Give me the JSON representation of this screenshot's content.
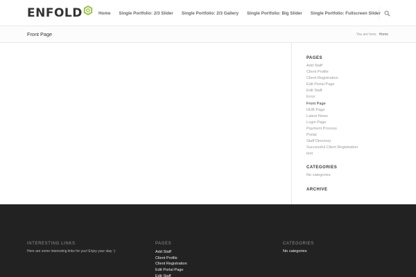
{
  "header": {
    "logo_text": "ENFOLD",
    "nav": [
      "Home",
      "Single Portfolio: 2/3 Slider",
      "Single Portfolio: 2/3 Gallery",
      "Single Portfolio: Big Slider",
      "Single Portfolio: Fullscreen Slider"
    ],
    "search_icon": "search-icon",
    "accent_color": "#9cc2464"
  },
  "titlebar": {
    "title": "Front Page",
    "breadcrumb_prefix": "You are here:",
    "breadcrumb_home": "Home"
  },
  "sidebar": {
    "pages_title": "PAGES",
    "pages": [
      "Add Staff",
      "Client Profile",
      "Client Registration",
      "Edit Portal Page",
      "Edit Staff",
      "Error",
      "Front Page",
      "HUB Page",
      "Latest News",
      "Login Page",
      "Payment Process",
      "Portal",
      "Staff Directory",
      "Successful Client Registration",
      "test"
    ],
    "current_page": "Front Page",
    "categories_title": "CATEGORIES",
    "categories_empty": "No categories",
    "archive_title": "ARCHIVE"
  },
  "footer": {
    "links_title": "INTERESTING LINKS",
    "links_text": "Here are some interesting links for you! Enjoy your stay :)",
    "pages_title": "PAGES",
    "pages": [
      "Add Staff",
      "Client Profile",
      "Client Registration",
      "Edit Portal Page",
      "Edit Staff"
    ],
    "categories_title": "CATEGORIES",
    "categories_empty": "No categories"
  }
}
